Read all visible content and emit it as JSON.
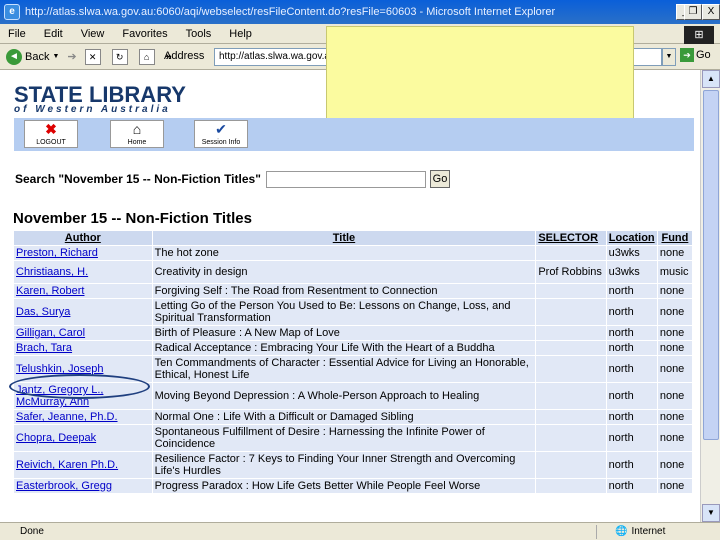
{
  "window": {
    "title": "http://atlas.slwa.wa.gov.au:6060/aqi/webselect/resFileContent.do?resFile=60603 - Microsoft Internet Explorer",
    "min": "_",
    "max": "□",
    "close": "X"
  },
  "menu": {
    "items": [
      "File",
      "Edit",
      "View",
      "Favorites",
      "Tools",
      "Help"
    ]
  },
  "toolbar": {
    "back": "Back",
    "more": "»",
    "address_label": "Address",
    "address": "http://atlas.slwa.wa.gov.au:6060/aqi/webselect/resFileContent.do?resFile=60603",
    "go": "Go"
  },
  "logo": {
    "line1a": "STATE",
    "line1b": "LIBRARY",
    "line2": "of Western Australia"
  },
  "nav": {
    "logout": "LOGOUT",
    "home": "Home",
    "session": "Session Info"
  },
  "search": {
    "label": "Search \"November 15 -- Non-Fiction Titles\"",
    "go": "Go"
  },
  "list": {
    "heading": "November 15 -- Non-Fiction Titles",
    "columns": [
      "Author",
      "Title",
      "SELECTOR",
      "Location",
      "Fund"
    ],
    "rows": [
      {
        "author": "Preston, Richard",
        "title": "The hot zone",
        "selector": "",
        "location": "u3wks",
        "fund": "none"
      },
      {
        "author": "Christiaans, H.",
        "title": "Creativity in design",
        "selector": "Prof Robbins",
        "location": "u3wks",
        "fund": "music"
      },
      {
        "author": "Karen, Robert",
        "title": "Forgiving Self : The Road from Resentment to Connection",
        "selector": "",
        "location": "north",
        "fund": "none"
      },
      {
        "author": "Das, Surya",
        "title": "Letting Go of the Person You Used to Be: Lessons on Change, Loss, and Spiritual Transformation",
        "selector": "",
        "location": "north",
        "fund": "none"
      },
      {
        "author": "Gilligan, Carol",
        "title": "Birth of Pleasure : A New Map of Love",
        "selector": "",
        "location": "north",
        "fund": "none"
      },
      {
        "author": "Brach, Tara",
        "title": "Radical Acceptance : Embracing Your Life With the Heart of a Buddha",
        "selector": "",
        "location": "north",
        "fund": "none"
      },
      {
        "author": "Telushkin, Joseph",
        "title": "Ten Commandments of Character : Essential Advice for Living an Honorable, Ethical, Honest Life",
        "selector": "",
        "location": "north",
        "fund": "none"
      },
      {
        "author": "Jantz, Gregory L., McMurray, Ann",
        "title": "Moving Beyond Depression : A Whole-Person Approach to Healing",
        "selector": "",
        "location": "north",
        "fund": "none"
      },
      {
        "author": "Safer, Jeanne, Ph.D.",
        "title": "Normal One : Life With a Difficult or Damaged Sibling",
        "selector": "",
        "location": "north",
        "fund": "none"
      },
      {
        "author": "Chopra, Deepak",
        "title": "Spontaneous Fulfillment of Desire : Harnessing the Infinite Power of Coincidence",
        "selector": "",
        "location": "north",
        "fund": "none"
      },
      {
        "author": "Reivich, Karen Ph.D.",
        "title": "Resilience Factor : 7 Keys to Finding Your Inner Strength and Overcoming Life's Hurdles",
        "selector": "",
        "location": "north",
        "fund": "none"
      },
      {
        "author": "Easterbrook, Gregg",
        "title": "Progress Paradox : How Life Gets Better While People Feel Worse",
        "selector": "",
        "location": "north",
        "fund": "none"
      }
    ]
  },
  "status": {
    "left": "Done",
    "zone": "Internet"
  }
}
